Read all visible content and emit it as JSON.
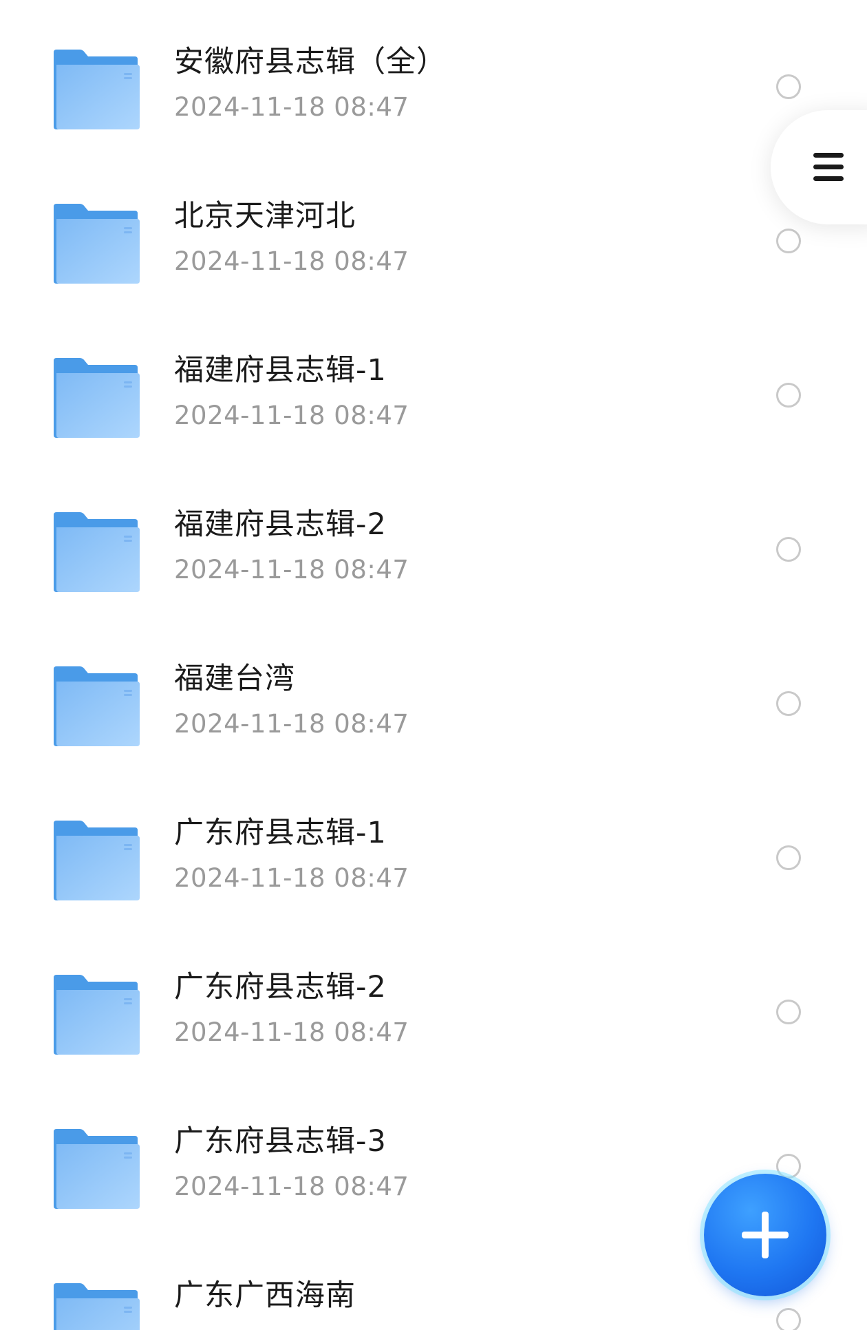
{
  "colors": {
    "folder_back": "#4a9be8",
    "folder_front": "#8ec6fb",
    "accent": "#1f77f2",
    "title_text": "#1b1b1b",
    "meta_text": "#9a9a9a"
  },
  "icons": {
    "folder": "folder-icon",
    "menu": "menu-icon",
    "add": "plus-icon",
    "select": "radio-circle"
  },
  "files": [
    {
      "name": "安徽府县志辑（全）",
      "modified": "2024-11-18 08:47"
    },
    {
      "name": "北京天津河北",
      "modified": "2024-11-18 08:47"
    },
    {
      "name": "福建府县志辑-1",
      "modified": "2024-11-18 08:47"
    },
    {
      "name": "福建府县志辑-2",
      "modified": "2024-11-18 08:47"
    },
    {
      "name": "福建台湾",
      "modified": "2024-11-18 08:47"
    },
    {
      "name": "广东府县志辑-1",
      "modified": "2024-11-18 08:47"
    },
    {
      "name": "广东府县志辑-2",
      "modified": "2024-11-18 08:47"
    },
    {
      "name": "广东府县志辑-3",
      "modified": "2024-11-18 08:47"
    },
    {
      "name": "广东广西海南",
      "modified": ""
    }
  ]
}
